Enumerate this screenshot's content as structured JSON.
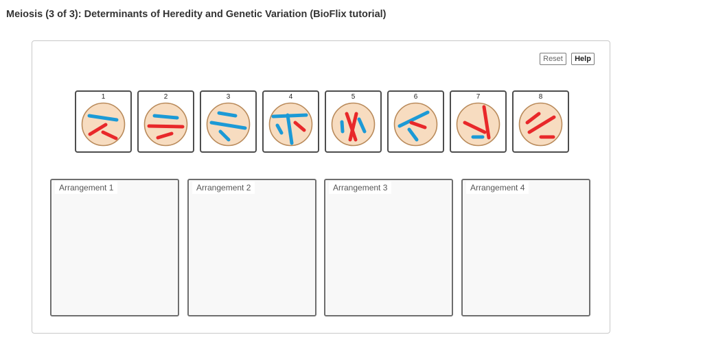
{
  "page_title": "Meiosis (3 of 3): Determinants of Heredity and Genetic Variation (BioFlix tutorial)",
  "toolbar": {
    "reset_label": "Reset",
    "help_label": "Help"
  },
  "colors": {
    "maternal": "#e8282a",
    "paternal": "#1c9ad6",
    "cell_fill": "#f7dcc0",
    "cell_border": "#b98a5a"
  },
  "tiles": [
    {
      "number": "1"
    },
    {
      "number": "2"
    },
    {
      "number": "3"
    },
    {
      "number": "4"
    },
    {
      "number": "5"
    },
    {
      "number": "6"
    },
    {
      "number": "7"
    },
    {
      "number": "8"
    }
  ],
  "arrangements": [
    {
      "label": "Arrangement 1"
    },
    {
      "label": "Arrangement 2"
    },
    {
      "label": "Arrangement 3"
    },
    {
      "label": "Arrangement 4"
    }
  ]
}
